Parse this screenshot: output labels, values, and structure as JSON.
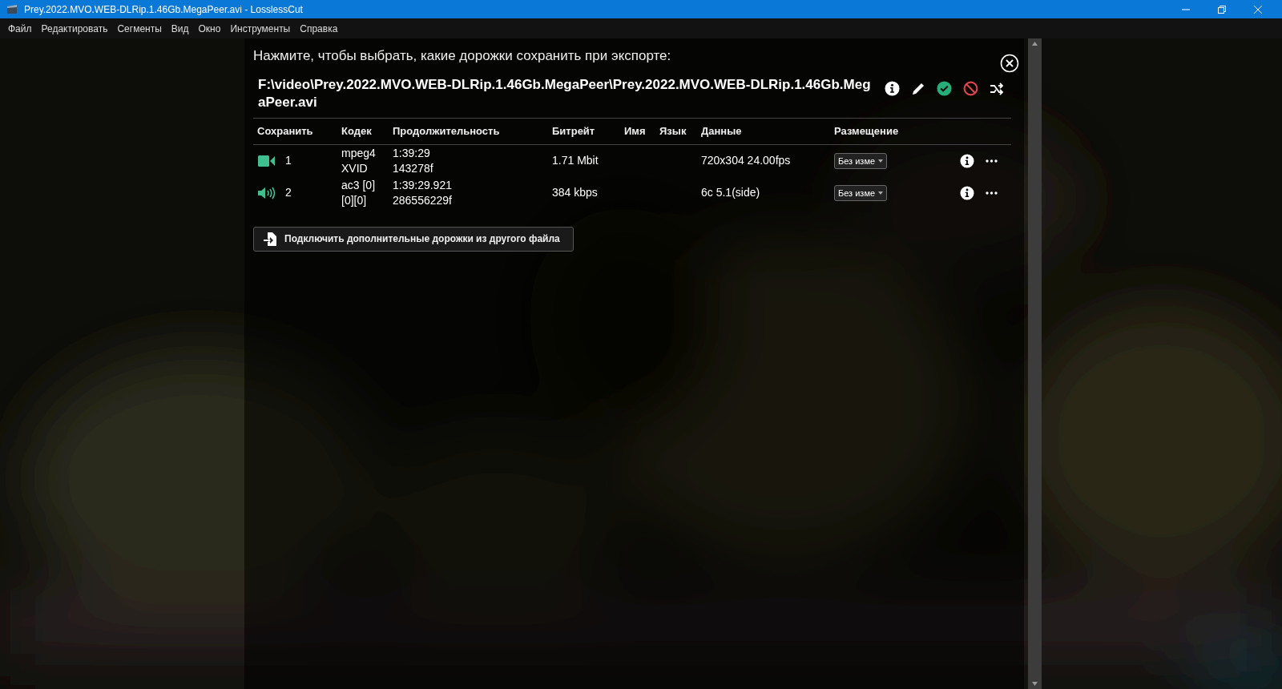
{
  "window": {
    "title": "Prey.2022.MVO.WEB-DLRip.1.46Gb.MegaPeer.avi - LosslessCut"
  },
  "menu": [
    "Файл",
    "Редактировать",
    "Сегменты",
    "Вид",
    "Окно",
    "Инструменты",
    "Справка"
  ],
  "dialog": {
    "heading": "Нажмите, чтобы выбрать, какие дорожки сохранить при экспорте:",
    "file_path": "F:\\video\\Prey.2022.MVO.WEB-DLRip.1.46Gb.MegaPeer\\Prey.2022.MVO.WEB-DLRip.1.46Gb.MegaPeer.avi",
    "columns": [
      "Сохранить",
      "Кодек",
      "Продолжительность",
      "Битрейт",
      "Имя",
      "Язык",
      "Данные",
      "Размещение"
    ],
    "tracks": [
      {
        "kind": "video",
        "kept": true,
        "index": "1",
        "codec": [
          "mpeg4",
          "XVID"
        ],
        "duration": [
          "1:39:29",
          "143278f"
        ],
        "bitrate": "1.71 Mbit",
        "data": "720x304 24.00fps",
        "placement": "Без изме"
      },
      {
        "kind": "audio",
        "kept": true,
        "index": "2",
        "codec": [
          "ac3 [0]",
          "[0][0]"
        ],
        "duration": [
          "1:39:29.921",
          "286556229f"
        ],
        "bitrate": "384 kbps",
        "data": "6c 5.1(side)",
        "placement": "Без изме"
      }
    ],
    "include_button": "Подключить дополнительные дорожки из другого файла"
  }
}
